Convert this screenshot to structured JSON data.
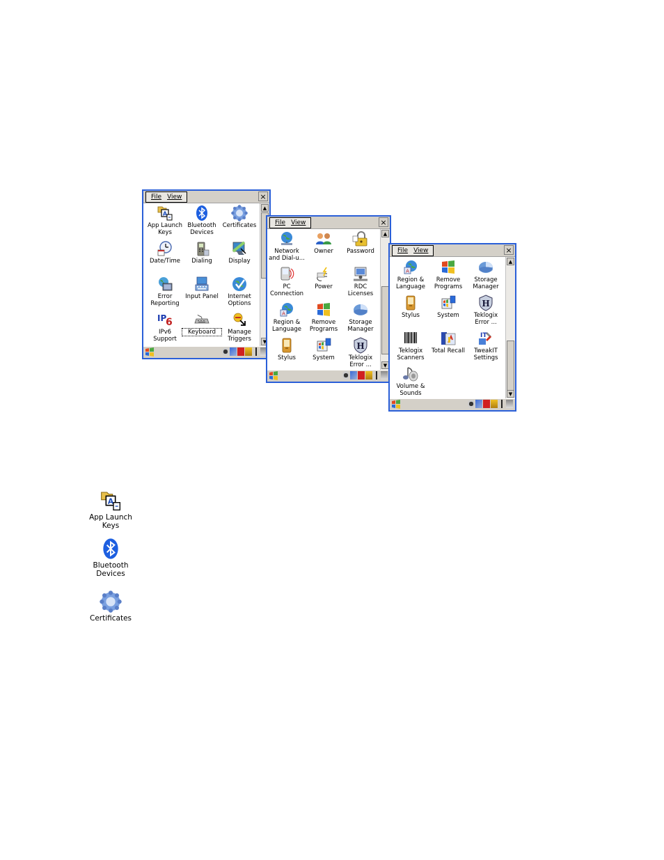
{
  "windows": [
    {
      "menu": {
        "file": "File",
        "view": "View"
      },
      "close": "×",
      "items": [
        {
          "label": "App Launch\nKeys",
          "icon": "app-launch-keys-icon"
        },
        {
          "label": "Bluetooth\nDevices",
          "icon": "bluetooth-icon"
        },
        {
          "label": "Certificates",
          "icon": "certificates-icon"
        },
        {
          "label": "Date/Time",
          "icon": "date-time-icon"
        },
        {
          "label": "Dialing",
          "icon": "dialing-icon"
        },
        {
          "label": "Display",
          "icon": "display-icon"
        },
        {
          "label": "Error\nReporting",
          "icon": "error-reporting-icon"
        },
        {
          "label": "Input Panel",
          "icon": "input-panel-icon"
        },
        {
          "label": "Internet\nOptions",
          "icon": "internet-options-icon"
        },
        {
          "label": "IPv6\nSupport",
          "icon": "ipv6-icon"
        },
        {
          "label": "Keyboard",
          "icon": "keyboard-icon"
        },
        {
          "label": "Manage\nTriggers",
          "icon": "manage-triggers-icon"
        }
      ]
    },
    {
      "menu": {
        "file": "File",
        "view": "View"
      },
      "close": "×",
      "items": [
        {
          "label": "Network\nand Dial-u...",
          "icon": "network-icon"
        },
        {
          "label": "Owner",
          "icon": "owner-icon"
        },
        {
          "label": "Password",
          "icon": "password-icon"
        },
        {
          "label": "PC\nConnection",
          "icon": "pc-connection-icon"
        },
        {
          "label": "Power",
          "icon": "power-icon"
        },
        {
          "label": "RDC\nLicenses",
          "icon": "rdc-licenses-icon"
        },
        {
          "label": "Region &\nLanguage",
          "icon": "region-language-icon"
        },
        {
          "label": "Remove\nPrograms",
          "icon": "remove-programs-icon"
        },
        {
          "label": "Storage\nManager",
          "icon": "storage-manager-icon"
        },
        {
          "label": "Stylus",
          "icon": "stylus-icon"
        },
        {
          "label": "System",
          "icon": "system-icon"
        },
        {
          "label": "Teklogix\nError ...",
          "icon": "teklogix-error-icon"
        }
      ]
    },
    {
      "menu": {
        "file": "File",
        "view": "View"
      },
      "close": "×",
      "items": [
        {
          "label": "Region &\nLanguage",
          "icon": "region-language-icon"
        },
        {
          "label": "Remove\nPrograms",
          "icon": "remove-programs-icon"
        },
        {
          "label": "Storage\nManager",
          "icon": "storage-manager-icon"
        },
        {
          "label": "Stylus",
          "icon": "stylus-icon"
        },
        {
          "label": "System",
          "icon": "system-icon"
        },
        {
          "label": "Teklogix\nError ...",
          "icon": "teklogix-error-icon"
        },
        {
          "label": "Teklogix\nScanners",
          "icon": "barcode-scanner-icon"
        },
        {
          "label": "Total Recall",
          "icon": "total-recall-icon"
        },
        {
          "label": "TweakIT\nSettings",
          "icon": "tweakit-icon"
        },
        {
          "label": "Volume &\nSounds",
          "icon": "volume-sounds-icon"
        }
      ]
    }
  ],
  "large_icons": [
    {
      "label": "App Launch\nKeys",
      "icon": "app-launch-keys-icon"
    },
    {
      "label": "Bluetooth\nDevices",
      "icon": "bluetooth-icon"
    },
    {
      "label": "Certificates",
      "icon": "certificates-icon"
    }
  ]
}
